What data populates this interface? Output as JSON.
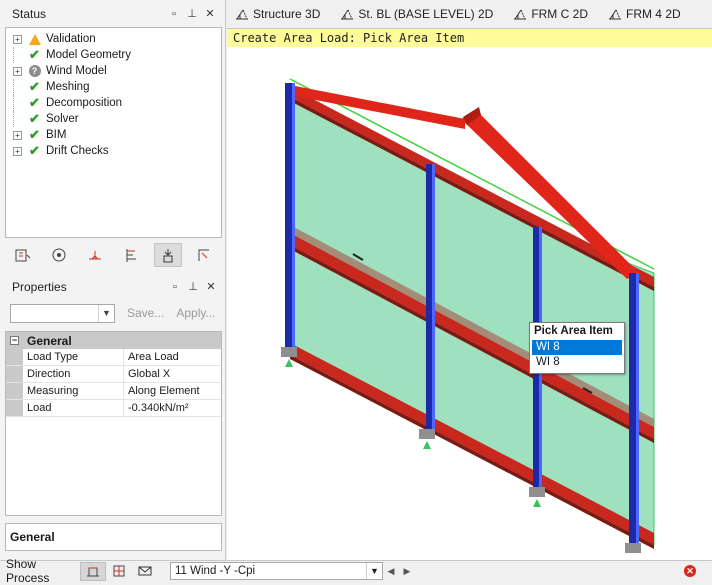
{
  "status_panel": {
    "title": "Status",
    "items": [
      {
        "label": "Validation",
        "icon": "warning-icon",
        "expandable": true
      },
      {
        "label": "Model Geometry",
        "icon": "check-icon",
        "expandable": false
      },
      {
        "label": "Wind Model",
        "icon": "question-icon",
        "expandable": true
      },
      {
        "label": "Meshing",
        "icon": "check-icon",
        "expandable": false
      },
      {
        "label": "Decomposition",
        "icon": "check-icon",
        "expandable": false
      },
      {
        "label": "Solver",
        "icon": "check-icon",
        "expandable": false
      },
      {
        "label": "BIM",
        "icon": "check-icon",
        "expandable": true
      },
      {
        "label": "Drift Checks",
        "icon": "check-icon",
        "expandable": true
      }
    ]
  },
  "properties_panel": {
    "title": "Properties",
    "save_label": "Save...",
    "apply_label": "Apply...",
    "category": "General",
    "rows": [
      {
        "key": "Load Type",
        "value": "Area Load"
      },
      {
        "key": "Direction",
        "value": "Global X"
      },
      {
        "key": "Measuring",
        "value": "Along Element"
      },
      {
        "key": "Load",
        "value": "-0.340kN/m²"
      }
    ],
    "description_title": "General"
  },
  "tabs": [
    "Structure 3D",
    "St. BL (BASE LEVEL) 2D",
    "FRM C 2D",
    "FRM 4 2D"
  ],
  "banner": "Create Area Load: Pick Area Item",
  "pick_popup": {
    "title": "Pick Area Item",
    "items": [
      "WI 8",
      "WI 8"
    ],
    "selected_index": 0
  },
  "bottom_bar": {
    "show_process_label": "Show Process",
    "load_case": "11 Wind -Y -Cpi"
  },
  "colors": {
    "banner_bg": "#fffb9a",
    "selection": "#0078d7",
    "column_blue": "#1c2aa8",
    "beam_red": "#d42a20",
    "panel_green": "#7fd6a8"
  }
}
